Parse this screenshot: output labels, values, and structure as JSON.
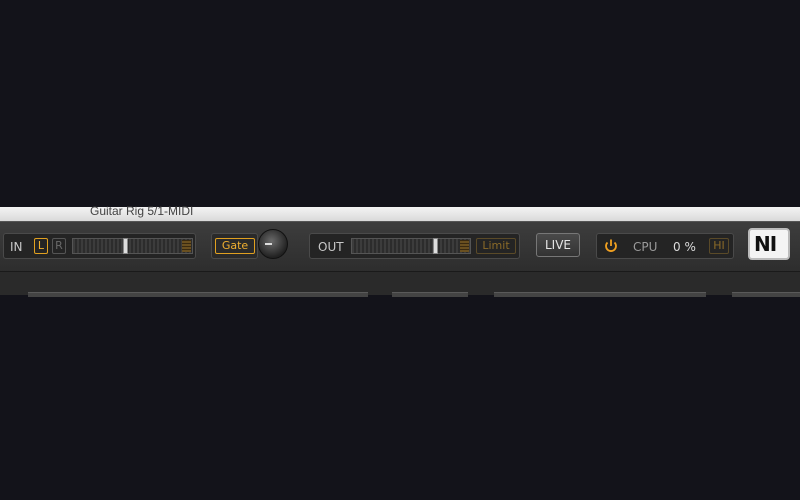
{
  "window": {
    "title": "Guitar Rig 5/1-MIDI"
  },
  "input": {
    "label": "IN",
    "left_channel": "L",
    "right_channel": "R",
    "level_percent": 44
  },
  "gate": {
    "label": "Gate"
  },
  "output": {
    "label": "OUT",
    "limit_label": "Limit",
    "level_percent": 72
  },
  "live_button": {
    "label": "LIVE"
  },
  "cpu": {
    "label": "CPU",
    "value": "0 %",
    "hi_label": "HI"
  },
  "logo": {
    "text": "NI"
  },
  "colors": {
    "accent_orange": "#f0b030",
    "panel": "#2e2e2e",
    "background": "#13131a"
  },
  "icons": [
    "power-icon",
    "ni-logo"
  ]
}
